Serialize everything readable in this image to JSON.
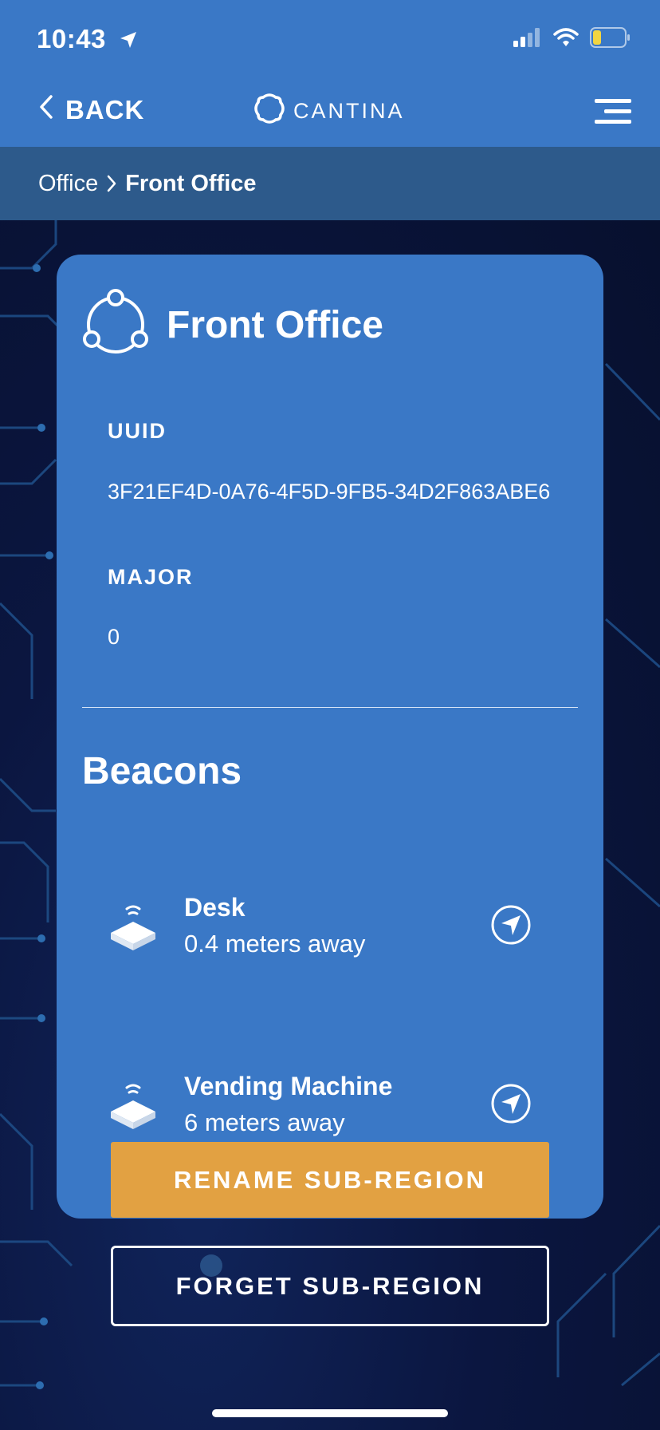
{
  "status_bar": {
    "time": "10:43",
    "location_icon": "location-arrow-icon",
    "signal_icon": "cellular-signal-icon",
    "wifi_icon": "wifi-icon",
    "battery_icon": "battery-low-icon",
    "battery_color": "#f2d541"
  },
  "nav": {
    "back_label": "BACK",
    "logo_text": "CANTINA",
    "menu_icon": "hamburger-menu-icon"
  },
  "breadcrumb": {
    "parent": "Office",
    "current": "Front Office"
  },
  "card": {
    "title": "Front Office",
    "icon": "region-nodes-icon",
    "uuid_label": "UUID",
    "uuid_value": "3F21EF4D-0A76-4F5D-9FB5-34D2F863ABE6",
    "major_label": "MAJOR",
    "major_value": "0",
    "beacons_title": "Beacons",
    "beacons": [
      {
        "name": "Desk",
        "distance": "0.4 meters away"
      },
      {
        "name": "Vending Machine",
        "distance": "6 meters away"
      }
    ]
  },
  "actions": {
    "rename_label": "RENAME SUB-REGION",
    "forget_label": "FORGET SUB-REGION"
  },
  "colors": {
    "primary": "#3a78c6",
    "breadcrumb_bg": "#2d5a8b",
    "accent": "#e2a142",
    "background": "#0a1436"
  }
}
